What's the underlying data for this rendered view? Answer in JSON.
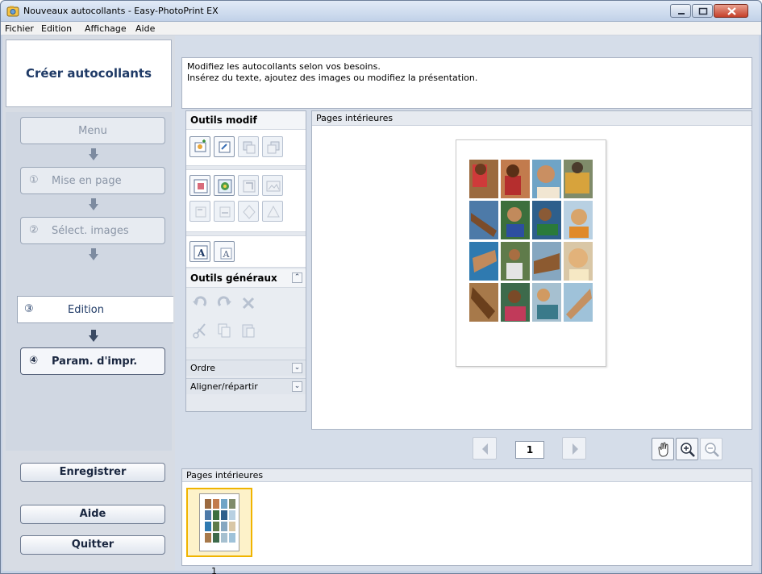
{
  "window": {
    "title": "Nouveaux autocollants - Easy-PhotoPrint EX"
  },
  "menubar": [
    "Fichier",
    "Edition",
    "Affichage",
    "Aide"
  ],
  "nav": {
    "title": "Créer autocollants",
    "steps": [
      {
        "num": "",
        "label": "Menu",
        "state": "disabled"
      },
      {
        "num": "①",
        "label": "Mise en page",
        "state": "disabled"
      },
      {
        "num": "②",
        "label": "Sélect. images",
        "state": "disabled"
      },
      {
        "num": "③",
        "label": "Edition",
        "state": "current"
      },
      {
        "num": "④",
        "label": "Param. d'impr.",
        "state": "enabled"
      }
    ],
    "save_label": "Enregistrer",
    "help_label": "Aide",
    "quit_label": "Quitter"
  },
  "hint": {
    "line1": "Modifiez les autocollants selon vos besoins.",
    "line2": "Insérez du texte, ajoutez des images ou modifiez la présentation."
  },
  "tools": {
    "edit_header": "Outils modif",
    "general_header": "Outils généraux",
    "order_label": "Ordre",
    "align_label": "Aligner/répartir"
  },
  "preview": {
    "header": "Pages intérieures",
    "page_number": "1"
  },
  "thumbnails": {
    "header": "Pages intérieures",
    "items": [
      {
        "label": "1"
      }
    ]
  },
  "colors": {
    "accent_title": "#1f3a66",
    "selection": "#f0b400",
    "close_button": "#c4402a"
  }
}
